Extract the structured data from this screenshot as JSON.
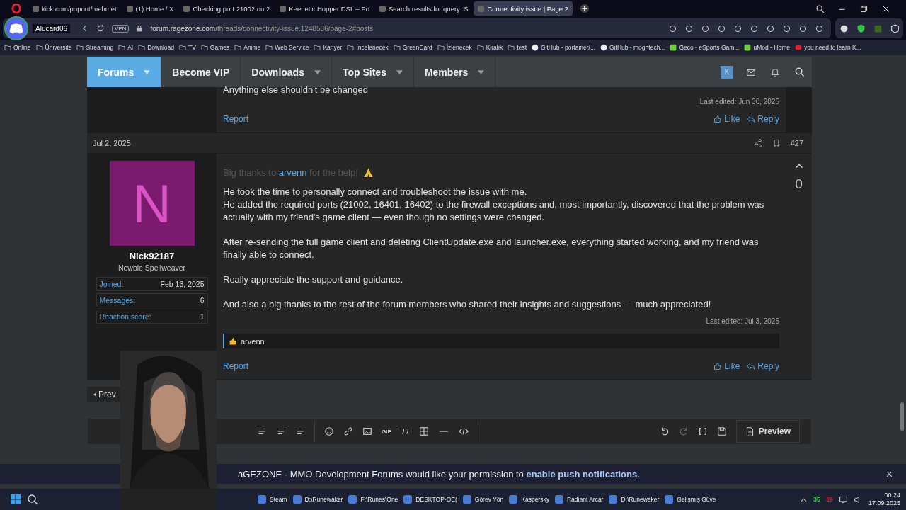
{
  "browser": {
    "tabs": [
      {
        "title": "kick.com/popout/mehmet",
        "selected": false
      },
      {
        "title": "(1) Home / X",
        "selected": false
      },
      {
        "title": "Checking port 21002 on 2",
        "selected": false
      },
      {
        "title": "Keenetic Hopper DSL – Po",
        "selected": false
      },
      {
        "title": "Search results for query: S",
        "selected": false
      },
      {
        "title": "Connectivity issue | Page 2",
        "selected": true
      }
    ],
    "overlay": {
      "username": "Alucard06"
    },
    "vpn_badge": "VPN",
    "url": {
      "host": "forum.ragezone.com",
      "path": "/threads/connectivity-issue.1248536/page-2#posts"
    },
    "bookmarks": [
      {
        "label": "Online",
        "kind": "folder"
      },
      {
        "label": "Üniversite",
        "kind": "folder"
      },
      {
        "label": "Streaming",
        "kind": "folder"
      },
      {
        "label": "AI",
        "kind": "folder"
      },
      {
        "label": "Download",
        "kind": "folder"
      },
      {
        "label": "TV",
        "kind": "folder"
      },
      {
        "label": "Games",
        "kind": "folder"
      },
      {
        "label": "Anime",
        "kind": "folder"
      },
      {
        "label": "Web Service",
        "kind": "folder"
      },
      {
        "label": "Kariyer",
        "kind": "folder"
      },
      {
        "label": "İncelenecek",
        "kind": "folder"
      },
      {
        "label": "GreenCard",
        "kind": "folder"
      },
      {
        "label": "İzlenecek",
        "kind": "folder"
      },
      {
        "label": "Kiralık",
        "kind": "folder"
      },
      {
        "label": "test",
        "kind": "folder"
      },
      {
        "label": "GitHub - portainer/...",
        "kind": "github"
      },
      {
        "label": "GitHub - moghtech...",
        "kind": "github"
      },
      {
        "label": "Geco - eSports Gam...",
        "kind": "site"
      },
      {
        "label": "uMod - Home",
        "kind": "site"
      },
      {
        "label": "you need to learn K...",
        "kind": "video"
      }
    ]
  },
  "nav": {
    "items": [
      {
        "label": "Forums",
        "selected": true,
        "has_menu": true
      },
      {
        "label": "Become VIP",
        "selected": false,
        "has_menu": false
      },
      {
        "label": "Downloads",
        "selected": false,
        "has_menu": true
      },
      {
        "label": "Top Sites",
        "selected": false,
        "has_menu": true
      },
      {
        "label": "Members",
        "selected": false,
        "has_menu": true
      }
    ],
    "user_initial": "K"
  },
  "previous_post": {
    "text": "Anything else shouldn't be changed",
    "last_edited": "Last edited: Jun 30, 2025",
    "report": "Report",
    "like": "Like",
    "reply": "Reply"
  },
  "post": {
    "date": "Jul 2, 2025",
    "number": "#27",
    "author": {
      "initial": "N",
      "name": "Nick92187",
      "title": "Newbie Spellweaver",
      "stats": [
        {
          "label": "Joined:",
          "value": "Feb 13, 2025"
        },
        {
          "label": "Messages:",
          "value": "6"
        },
        {
          "label": "Reaction score:",
          "value": "1"
        }
      ]
    },
    "intro": {
      "before": "Big thanks to ",
      "mention": "arvenn",
      "after": " for the help!"
    },
    "paragraphs": [
      "He took the time to personally connect and troubleshoot the issue with me.\nHe added the required ports (21002, 16401, 16402) to the firewall exceptions and, most importantly, discovered that the problem was actually with my friend's game client — even though no settings were changed.",
      "After re-sending the full game client and deleting ClientUpdate.exe and launcher.exe, everything started working, and my friend was finally able to connect.",
      "Really appreciate the support and guidance.",
      "And also a big thanks to the rest of the forum members who shared their insights and suggestions — much appreciated!"
    ],
    "last_edited": "Last edited: Jul 3, 2025",
    "reaction_user": "arvenn",
    "report": "Report",
    "like": "Like",
    "reply": "Reply",
    "score": "0"
  },
  "pager": {
    "prev": "Prev"
  },
  "editor": {
    "gif": "GIF",
    "preview": "Preview"
  },
  "notice": {
    "text": "aGEZONE - MMO Development Forums would like your permission to ",
    "link": "enable push notifications",
    "end": "."
  },
  "taskbar": {
    "apps": [
      {
        "label": "Steam"
      },
      {
        "label": "D:\\Runewaker"
      },
      {
        "label": "F:\\Runes\\One"
      },
      {
        "label": "DESKTOP-OE("
      },
      {
        "label": "Görev Yön"
      },
      {
        "label": "Kaspersky"
      },
      {
        "label": "Radiant Arcar"
      },
      {
        "label": "D:\\Runewaker"
      },
      {
        "label": "Gelişmiş Güve"
      }
    ],
    "readings": [
      {
        "text": "35",
        "color": "#2ecc40"
      },
      {
        "text": "39",
        "color": "#d0203a"
      }
    ],
    "time": "00:24",
    "date": "17.09.2025"
  }
}
